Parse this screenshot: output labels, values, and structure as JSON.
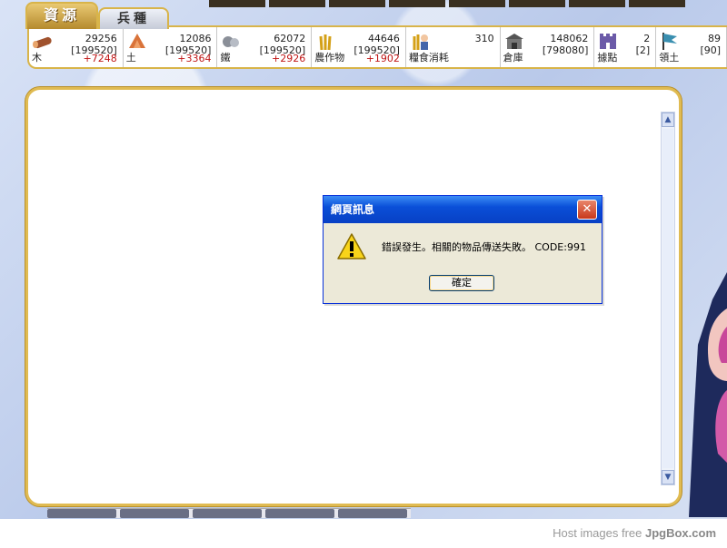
{
  "tabs": {
    "resources": "資源",
    "troops": "兵種"
  },
  "resources": [
    {
      "icon": "wood-icon",
      "name": "木",
      "amount": "29256",
      "capacity": "[199520]",
      "rate": "+7248"
    },
    {
      "icon": "earth-icon",
      "name": "土",
      "amount": "12086",
      "capacity": "[199520]",
      "rate": "+3364"
    },
    {
      "icon": "iron-icon",
      "name": "鐵",
      "amount": "62072",
      "capacity": "[199520]",
      "rate": "+2926"
    },
    {
      "icon": "crop-icon",
      "name": "農作物",
      "amount": "44646",
      "capacity": "[199520]",
      "rate": "+1902"
    },
    {
      "icon": "grain-consumption-icon",
      "name": "糧食消耗",
      "amount": "310",
      "capacity": "",
      "rate": ""
    },
    {
      "icon": "warehouse-icon",
      "name": "倉庫",
      "amount": "148062",
      "capacity": "[798080]",
      "rate": ""
    },
    {
      "icon": "stronghold-icon",
      "name": "據點",
      "amount": "2",
      "capacity": "[2]",
      "rate": ""
    },
    {
      "icon": "territory-flag-icon",
      "name": "領土",
      "amount": "89",
      "capacity": "[90]",
      "rate": ""
    }
  ],
  "dialog": {
    "title": "網頁訊息",
    "message": "錯誤發生。相關的物品傳送失敗。 CODE:991",
    "ok_label": "確定",
    "close_glyph": "✕"
  },
  "footer": {
    "credit_prefix": "Host images free ",
    "credit_brand": "JpgBox.com"
  },
  "colors": {
    "gold_border": "#d8b44a",
    "rate_red": "#c01515",
    "titlebar_blue": "#0a4fd8"
  }
}
